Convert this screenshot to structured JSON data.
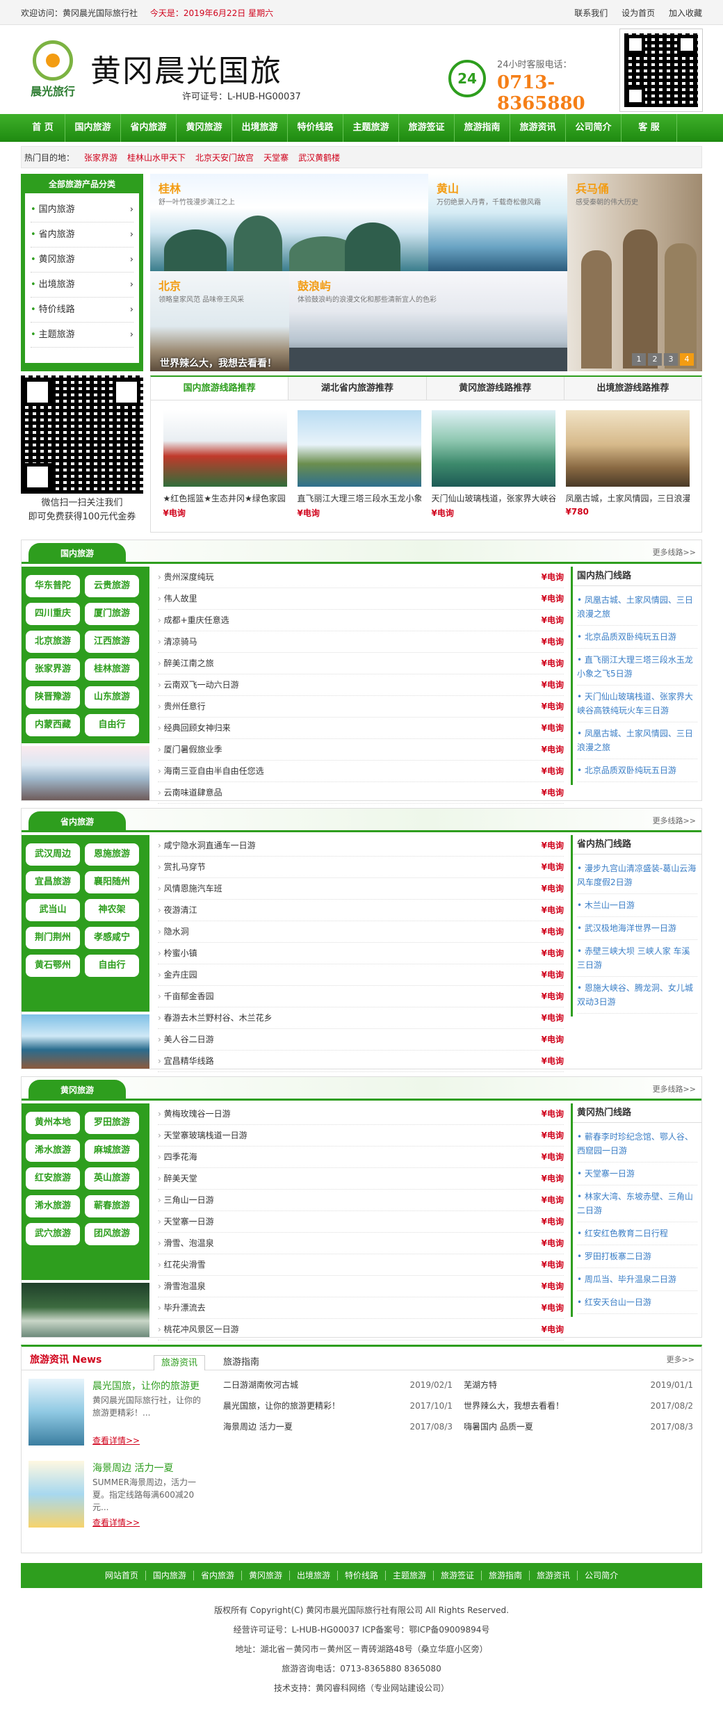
{
  "topbar": {
    "welcome": "欢迎访问：黄冈晨光国际旅行社",
    "today": "今天是：2019年6月22日 星期六",
    "links": [
      "联系我们",
      "设为首页",
      "加入收藏"
    ]
  },
  "header": {
    "logo_text": "晨光旅行",
    "brand": "黄冈晨光国旅",
    "license": "许可证号：L-HUB-HG00037",
    "hotline_label": "24小时客服电话：",
    "hotline": "0713-8365880",
    "clock_text": "24"
  },
  "nav": [
    "首 页",
    "国内旅游",
    "省内旅游",
    "黄冈旅游",
    "出境旅游",
    "特价线路",
    "主题旅游",
    "旅游签证",
    "旅游指南",
    "旅游资讯",
    "公司简介",
    "客 服"
  ],
  "hot": {
    "label": "热门目的地：",
    "items": [
      "张家界游",
      "桂林山水甲天下",
      "北京天安门故宫",
      "天堂寨",
      "武汉黄鹤楼"
    ]
  },
  "categories": {
    "title": "全部旅游产品分类",
    "items": [
      "国内旅游",
      "省内旅游",
      "黄冈旅游",
      "出境旅游",
      "特价线路",
      "主题旅游"
    ]
  },
  "banner": {
    "tiles": [
      {
        "title": "桂林",
        "sub": "舒一叶竹筏漫步漓江之上"
      },
      {
        "title": "黄山",
        "sub": "万仞绝景入丹青，千载奇松傲风霜"
      },
      {
        "title": "兵马俑",
        "sub": "感受秦朝的伟大历史"
      },
      {
        "title": "北京",
        "sub": "领略皇家风范 品味帝王风采"
      },
      {
        "title": "鼓浪屿",
        "sub": "体验鼓浪屿的浪漫文化和那些清新宜人的色彩"
      }
    ],
    "slogan": "世界辣么大，我想去看看！",
    "pages": [
      "1",
      "2",
      "3",
      "4"
    ]
  },
  "qr_caption": [
    "微信扫一扫关注我们",
    "即可免费获得100元代金券"
  ],
  "recs": {
    "tabs": [
      "国内旅游线路推荐",
      "湖北省内旅游推荐",
      "黄冈旅游线路推荐",
      "出境旅游线路推荐"
    ],
    "cards": [
      {
        "name": "★红色摇篮★生态井冈★绿色家园",
        "price": "¥电询"
      },
      {
        "name": "直飞丽江大理三塔三段水玉龙小象",
        "price": "¥电询"
      },
      {
        "name": "天门仙山玻璃栈道，张家界大峡谷",
        "price": "¥电询"
      },
      {
        "name": "凤凰古城，土家风情园，三日浪漫",
        "price": "¥780"
      }
    ]
  },
  "sections": [
    {
      "tag": "国内旅游",
      "more": "更多线路>>",
      "subs": [
        "华东普陀",
        "云贵旅游",
        "四川重庆",
        "厦门旅游",
        "北京旅游",
        "江西旅游",
        "张家界游",
        "桂林旅游",
        "陕晋豫游",
        "山东旅游",
        "内蒙西藏",
        "自由行"
      ],
      "list": [
        "贵州深度纯玩",
        "伟人故里",
        "成都+重庆任意选",
        "清凉骑马",
        "醉美江南之旅",
        "云南双飞一动六日游",
        "贵州任意行",
        "经典回顾女神归来",
        "厦门暑假旅业季",
        "海南三亚自由半自由任您选",
        "云南味道肆意品"
      ],
      "price": "¥电询",
      "side_title": "国内热门线路",
      "side": [
        "凤凰古城、土家风情园、三日浪漫之旅",
        "北京品质双卧纯玩五日游",
        "直飞丽江大理三塔三段水玉龙小象之飞5日游",
        "天门仙山玻璃栈道、张家界大峡谷高铁纯玩火车三日游",
        "凤凰古城、土家风情园、三日浪漫之旅",
        "北京品质双卧纯玩五日游"
      ]
    },
    {
      "tag": "省内旅游",
      "more": "更多线路>>",
      "subs": [
        "武汉周边",
        "恩施旅游",
        "宜昌旅游",
        "襄阳随州",
        "武当山",
        "神农架",
        "荆门荆州",
        "孝感咸宁",
        "黄石鄂州",
        "自由行"
      ],
      "list": [
        "咸宁隐水洞直通车一日游",
        "赏扎马穿节",
        "风情恩施汽车班",
        "夜游清江",
        "隐水洞",
        "柃蜜小镇",
        "金卉庄园",
        "千亩郁金香园",
        "春游去木兰野村谷、木兰花乡",
        "美人谷二日游",
        "宜昌精华线路"
      ],
      "price": "¥电询",
      "side_title": "省内热门线路",
      "side": [
        "漫步九宫山清凉盛装-葛山云海风车度假2日游",
        "木兰山一日游",
        "武汉极地海洋世界一日游",
        "赤壁三峡大坝 三峡人家 车溪三日游",
        "恩施大峡谷、腾龙洞、女儿城双动3日游"
      ]
    },
    {
      "tag": "黄冈旅游",
      "more": "更多线路>>",
      "subs": [
        "黄州本地",
        "罗田旅游",
        "浠水旅游",
        "麻城旅游",
        "红安旅游",
        "英山旅游",
        "浠水旅游",
        "蕲春旅游",
        "武穴旅游",
        "团风旅游"
      ],
      "list": [
        "黄梅玫瑰谷一日游",
        "天堂寨玻璃栈道一日游",
        "四季花海",
        "醉美天堂",
        "三角山一日游",
        "天堂寨一日游",
        "滑雪、泡温泉",
        "红花尖滑雪",
        "滑雪泡温泉",
        "毕升漂流去",
        "桃花冲风景区一日游"
      ],
      "price": "¥电询",
      "side_title": "黄冈热门线路",
      "side": [
        "蕲春李时珍纪念馆、鄂人谷、西窟园一日游",
        "天堂寨一日游",
        "林家大湾、东坡赤壁、三角山二日游",
        "红安红色教育二日行程",
        "罗田打板寨二日游",
        "周瓜当、毕升温泉二日游",
        "红安天台山一日游"
      ]
    }
  ],
  "news": {
    "title": "旅游资讯 News",
    "tabs": [
      "旅游资讯",
      "旅游指南"
    ],
    "more": "更多>>",
    "featured": [
      {
        "title": "晨光国旅，让你的旅游更",
        "desc": "黄冈晨光国际旅行社，让你的旅游更精彩！...",
        "link": "查看详情>>"
      },
      {
        "title": "海景周边 活力一夏",
        "desc": "SUMMER海景周边，活力一夏。指定线路每满600减20元...",
        "link": "查看详情>>"
      }
    ],
    "list_left": [
      {
        "t": "二日游湖南攸河古城",
        "d": "2019/02/1"
      },
      {
        "t": "晨光国旅，让你的旅游更精彩！",
        "d": "2017/10/1"
      },
      {
        "t": "海景周边 活力一夏",
        "d": "2017/08/3"
      }
    ],
    "list_right": [
      {
        "t": "芜湖方特",
        "d": "2019/01/1"
      },
      {
        "t": "世界辣么大，我想去看看！",
        "d": "2017/08/2"
      },
      {
        "t": "嗨暑国内 品质一夏",
        "d": "2017/08/3"
      }
    ]
  },
  "footer": {
    "nav": [
      "网站首页",
      "国内旅游",
      "省内旅游",
      "黄冈旅游",
      "出境旅游",
      "特价线路",
      "主题旅游",
      "旅游签证",
      "旅游指南",
      "旅游资讯",
      "公司简介"
    ],
    "lines": [
      "版权所有 Copyright(C) 黄冈市晨光国际旅行社有限公司 All Rights Reserved.",
      "经营许可证号：L-HUB-HG00037  ICP备案号：鄂ICP备09009894号",
      "地址：湖北省－黄冈市－黄州区－青砖湖路48号（桑立华庭小区旁）",
      "旅游咨询电话：0713-8365880 8365080",
      "技术支持：黄冈睿科网络（专业网站建设公司）"
    ]
  },
  "colors": {
    "green": "#2e9e1e",
    "red": "#d0021b",
    "orange": "#f57f17"
  }
}
